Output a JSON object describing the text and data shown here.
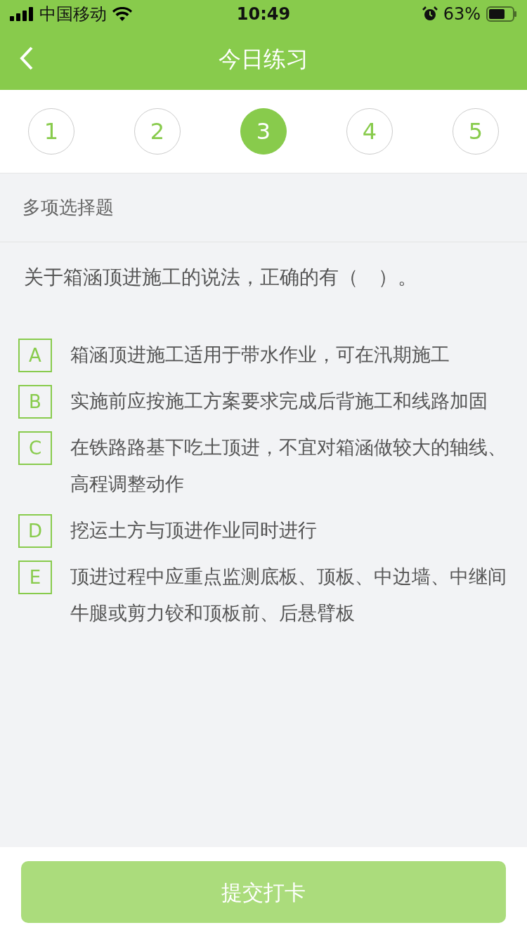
{
  "status_bar": {
    "carrier": "中国移动",
    "time": "10:49",
    "battery": "63%"
  },
  "nav": {
    "title": "今日练习"
  },
  "question_tabs": [
    {
      "label": "1",
      "selected": false
    },
    {
      "label": "2",
      "selected": false
    },
    {
      "label": "3",
      "selected": true
    },
    {
      "label": "4",
      "selected": false
    },
    {
      "label": "5",
      "selected": false
    }
  ],
  "question_type": "多项选择题",
  "question": "关于箱涵顶进施工的说法，正确的有（　）。",
  "options": [
    {
      "letter": "A",
      "text": "箱涵顶进施工适用于带水作业，可在汛期施工",
      "selected": false
    },
    {
      "letter": "B",
      "text": "实施前应按施工方案要求完成后背施工和线路加固",
      "selected": false
    },
    {
      "letter": "C",
      "text": "在铁路路基下吃土顶进，不宜对箱涵做较大的轴线、高程调整动作",
      "selected": false
    },
    {
      "letter": "D",
      "text": "挖运土方与顶进作业同时进行",
      "selected": false
    },
    {
      "letter": "E",
      "text": "顶进过程中应重点监测底板、顶板、中边墙、中继间牛腿或剪力铰和顶板前、后悬臂板",
      "selected": false
    }
  ],
  "submit_button": {
    "label": "提交打卡",
    "disabled": true
  }
}
